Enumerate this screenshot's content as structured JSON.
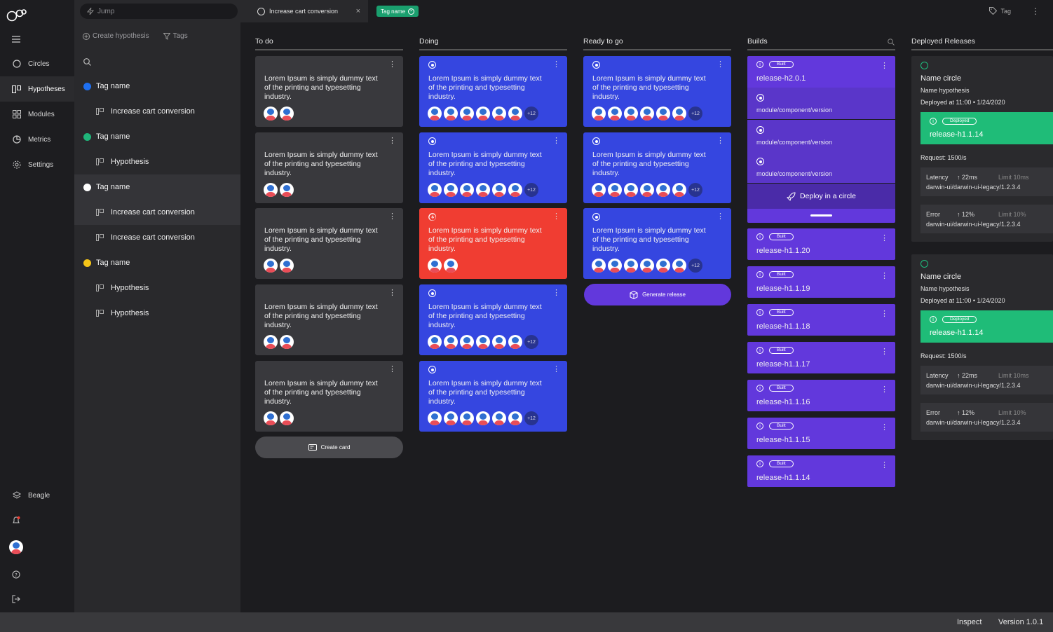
{
  "nav": {
    "items": [
      {
        "label": "Circles",
        "icon": "circle-icon"
      },
      {
        "label": "Hypotheses",
        "icon": "hypotheses-icon"
      },
      {
        "label": "Modules",
        "icon": "modules-icon"
      },
      {
        "label": "Metrics",
        "icon": "metrics-icon"
      },
      {
        "label": "Settings",
        "icon": "settings-icon"
      }
    ],
    "workspace": "Beagle"
  },
  "panel": {
    "jump_placeholder": "Jump",
    "create_hypothesis": "Create hypothesis",
    "tags": "Tags",
    "tree": [
      {
        "type": "tag",
        "label": "Tag name",
        "color": "#1e6ff0"
      },
      {
        "type": "hyp",
        "label": "Increase cart conversion"
      },
      {
        "type": "tag",
        "label": "Tag name",
        "color": "#1fb57a"
      },
      {
        "type": "hyp",
        "label": "Hypothesis"
      },
      {
        "type": "tag",
        "label": "Tag name",
        "color": "#ffffff"
      },
      {
        "type": "hyp",
        "label": "Increase cart conversion"
      },
      {
        "type": "hyp",
        "label": "Increase cart conversion"
      },
      {
        "type": "tag",
        "label": "Tag name",
        "color": "#f5c518"
      },
      {
        "type": "hyp",
        "label": "Hypothesis"
      },
      {
        "type": "hyp",
        "label": "Hypothesis"
      }
    ]
  },
  "topbar": {
    "tab_label": "Increase cart conversion",
    "close": "×",
    "tag_pill": "Tag name",
    "tag_action": "Tag"
  },
  "columns": {
    "todo": "To do",
    "doing": "Doing",
    "ready": "Ready to go",
    "builds": "Builds",
    "deployed": "Deployed Releases"
  },
  "card_text": "Lorem Ipsum is simply dummy text of the printing and typesetting industry.",
  "more_count": "+12",
  "create_card": "Create card",
  "generate_release": "Generate release",
  "builds": {
    "badge": "Built",
    "top_release": "release-h2.0.1",
    "modules": [
      "module/component/version",
      "module/component/version",
      "module/component/version"
    ],
    "deploy_label": "Deploy in a circle",
    "releases": [
      "release-h1.1.20",
      "release-h1.1.19",
      "release-h1.1.18",
      "release-h1.1.17",
      "release-h1.1.16",
      "release-h1.1.15",
      "release-h1.1.14"
    ]
  },
  "deployed": [
    {
      "name": "Name circle",
      "hypothesis": "Name hypothesis",
      "deployed_at": "Deployed at 11:00 • 1/24/2020",
      "badge": "Deployed",
      "release": "release-h1.1.14",
      "request": "Request: 1500/s",
      "latency": {
        "label": "Latency",
        "value": "22ms",
        "limit": "Limit 10ms",
        "source": "darwin-ui/darwin-ui-legacy/1.2.3.4"
      },
      "error": {
        "label": "Error",
        "value": "12%",
        "limit": "Limit 10%",
        "source": "darwin-ui/darwin-ui-legacy/1.2.3.4"
      }
    },
    {
      "name": "Name circle",
      "hypothesis": "Name hypothesis",
      "deployed_at": "Deployed at 11:00 • 1/24/2020",
      "badge": "Deployed",
      "release": "release-h1.1.14",
      "request": "Request: 1500/s",
      "latency": {
        "label": "Latency",
        "value": "22ms",
        "limit": "Limit 10ms",
        "source": "darwin-ui/darwin-ui-legacy/1.2.3.4"
      },
      "error": {
        "label": "Error",
        "value": "12%",
        "limit": "Limit 10%",
        "source": "darwin-ui/darwin-ui-legacy/1.2.3.4"
      }
    }
  ],
  "footer": {
    "inspect": "Inspect",
    "version": "Version 1.0.1"
  }
}
